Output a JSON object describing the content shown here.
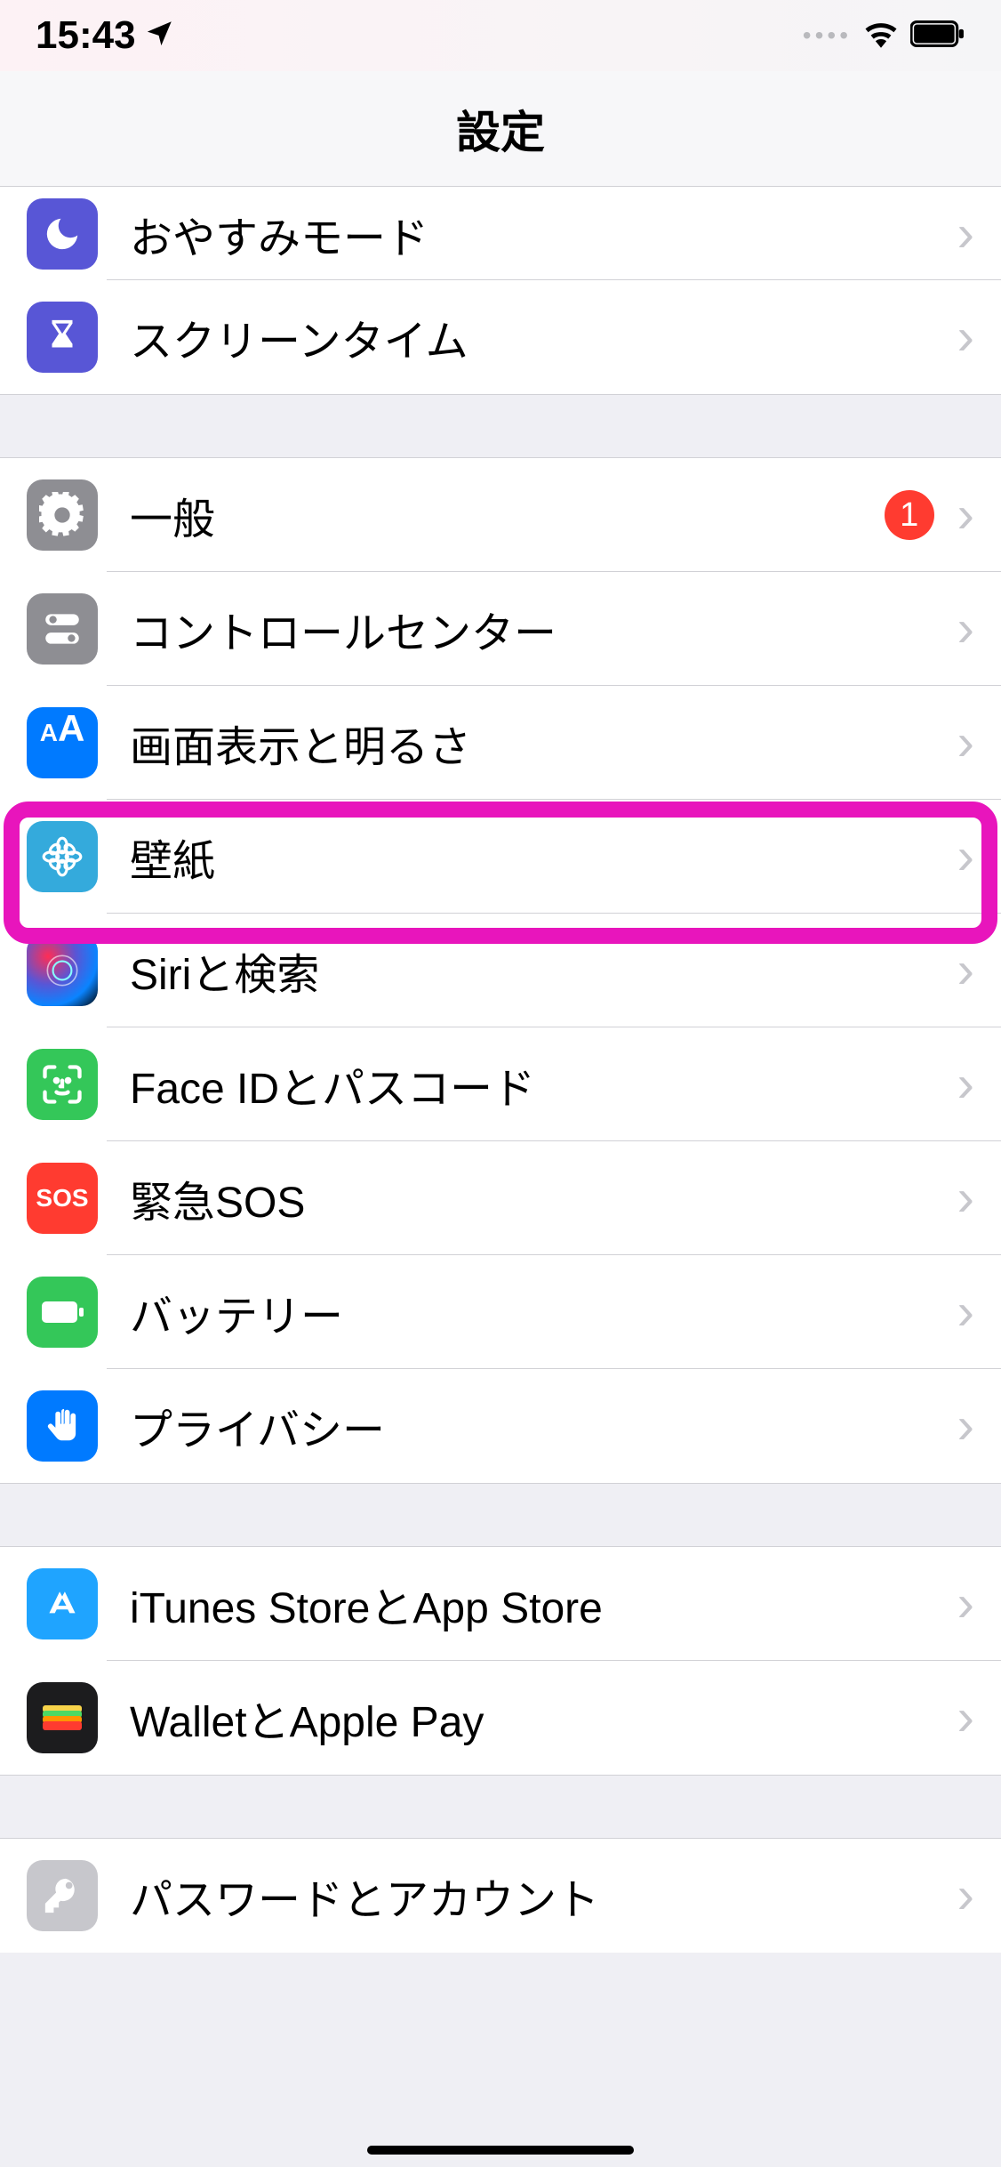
{
  "status": {
    "time": "15:43"
  },
  "header": {
    "title": "設定"
  },
  "groups": [
    {
      "rows": [
        {
          "id": "dnd",
          "label": "おやすみモード"
        },
        {
          "id": "screentime",
          "label": "スクリーンタイム"
        }
      ]
    },
    {
      "rows": [
        {
          "id": "general",
          "label": "一般",
          "badge": "1"
        },
        {
          "id": "control",
          "label": "コントロールセンター"
        },
        {
          "id": "display",
          "label": "画面表示と明るさ"
        },
        {
          "id": "wallpaper",
          "label": "壁紙",
          "highlighted": true
        },
        {
          "id": "siri",
          "label": "Siriと検索"
        },
        {
          "id": "faceid",
          "label": "Face IDとパスコード"
        },
        {
          "id": "sos",
          "label": "緊急SOS"
        },
        {
          "id": "battery",
          "label": "バッテリー"
        },
        {
          "id": "privacy",
          "label": "プライバシー"
        }
      ]
    },
    {
      "rows": [
        {
          "id": "itunes",
          "label": "iTunes StoreとApp Store"
        },
        {
          "id": "wallet",
          "label": "WalletとApple Pay"
        }
      ]
    },
    {
      "rows": [
        {
          "id": "passwords",
          "label": "パスワードとアカウント"
        }
      ]
    }
  ]
}
